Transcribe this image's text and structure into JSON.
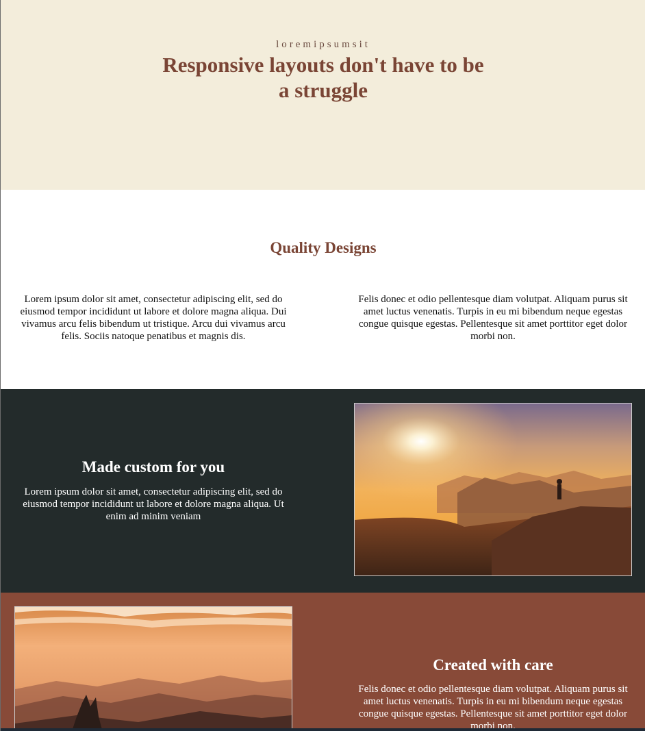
{
  "hero": {
    "kicker": "loremipsumsit",
    "title": "Responsive layouts don't have to be a struggle",
    "background": "#f3eddb",
    "title_color": "#7a4535"
  },
  "quality": {
    "heading": "Quality Designs",
    "left_text": "Lorem ipsum dolor sit amet, consectetur adipiscing elit, sed do eiusmod tempor incididunt ut labore et dolore magna aliqua. Dui vivamus arcu felis bibendum ut tristique. Arcu dui vivamus arcu felis. Sociis natoque penatibus et magnis dis.",
    "right_text": "Felis donec et odio pellentesque diam volutpat. Aliquam purus sit amet luctus venenatis. Turpis in eu mi bibendum neque egestas congue quisque egestas. Pellentesque sit amet porttitor eget dolor morbi non."
  },
  "custom": {
    "heading": "Made custom for you",
    "text": "Lorem ipsum dolor sit amet, consectetur adipiscing elit, sed do eiusmod tempor incididunt ut labore et dolore magna aliqua. Ut enim ad minim veniam",
    "background": "#232b2b",
    "image": "mountain-sunrise-hiker-photo"
  },
  "care": {
    "heading": "Created with care",
    "text": "Felis donec et odio pellentesque diam volutpat. Aliquam purus sit amet luctus venenatis. Turpis in eu mi bibendum neque egestas congue quisque egestas. Pellentesque sit amet porttitor eget dolor morbi non.",
    "background": "#884a38",
    "image": "misty-mountain-sunset-photo"
  }
}
